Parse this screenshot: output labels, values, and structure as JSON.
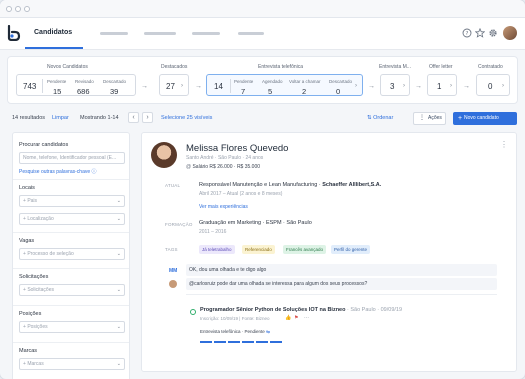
{
  "header": {
    "active_tab": "Candidatos",
    "icons": [
      "help-icon",
      "star-icon",
      "gear-icon"
    ]
  },
  "pipeline": {
    "novos": {
      "title": "Novos Candidatos",
      "total": "743",
      "sub": [
        {
          "label": "Pendente",
          "value": "15"
        },
        {
          "label": "Revisado",
          "value": "686"
        },
        {
          "label": "Descartado",
          "value": "39"
        }
      ]
    },
    "destacados": {
      "title": "Destacados",
      "total": "27"
    },
    "entrevista": {
      "title": "Entrevista telefônica",
      "total": "14",
      "sub": [
        {
          "label": "Pendente",
          "value": "7"
        },
        {
          "label": "Agendado",
          "value": "5"
        },
        {
          "label": "Voltar a chamar",
          "value": "2"
        },
        {
          "label": "Descartado",
          "value": "0"
        }
      ]
    },
    "entrevista_m": {
      "title": "Entrevista M...",
      "total": "3"
    },
    "offer": {
      "title": "Offer letter",
      "total": "1"
    },
    "contratado": {
      "title": "Contratado",
      "total": "0"
    }
  },
  "toolbar": {
    "results": "14 resultados",
    "clear": "Limpar",
    "showing": "Mostrando 1-14",
    "select_visible": "Selecione 25 visíveis",
    "order": "Ordenar",
    "actions": "Ações",
    "new_candidate": "Novo candidato"
  },
  "filters": {
    "search_label": "Procurar candidatos",
    "search_placeholder": "Nome, telefone, Identificador pessoal (E...",
    "search_other": "Pesquise outras palavras-chave",
    "locais": "Locais",
    "pais": "Pais",
    "localizacao": "Localização",
    "vagas": "Vagas",
    "processo": "Processo de seleção",
    "solicitacoes": "Solicitações",
    "solicitacoes_ph": "Solicitações",
    "posicoes": "Posições",
    "posicoes_ph": "Posições",
    "marcas": "Marcas",
    "marcas_ph": "Marcas"
  },
  "candidate": {
    "name": "Melissa Flores Quevedo",
    "location": "Santo André · São Paulo · 24 anos",
    "salary": "Salário R$ 26.000 · R$ 35.000",
    "atual_label": "ATUAL",
    "job": "Responsável Manutenção e Lean Manufacturing",
    "company": "Schaeffer Alllibert,S.A.",
    "job_period": "Abril 2017 – Atual (2 anos e 8 meses)",
    "more_exp": "Ver mais experiências",
    "formacao_label": "FORMAÇÃO",
    "education": "Graduação em Marketing · ESPM · São Paulo",
    "education_period": "2011 – 2016",
    "tags_label": "TAGS",
    "tags": [
      {
        "label": "Já teletrabalho",
        "bg": "#ece8fb",
        "fg": "#5c4bb8"
      },
      {
        "label": "Referenciado",
        "bg": "#fbf3d2",
        "fg": "#8a6d12"
      },
      {
        "label": "Francês avançado",
        "bg": "#def3e6",
        "fg": "#2b7a4b"
      },
      {
        "label": "Perfil do gerente",
        "bg": "#e1edfb",
        "fg": "#2f5fa8"
      }
    ],
    "comment_user": "MM",
    "comment1": "OK, dou uma olhada e te digo algo",
    "comment2": "@carlosruiz pode dar uma olhada se interessa para algum dos seus processos?",
    "application": {
      "title": "Programador Sênior Python de Soluções IOT na Bizneo",
      "location": "· São Paulo · 09/09/19",
      "meta": "Inscrição: 10/09/19 | Fonte: Bizneo",
      "stage": "Entrevista telefônica · Pendiente"
    }
  }
}
